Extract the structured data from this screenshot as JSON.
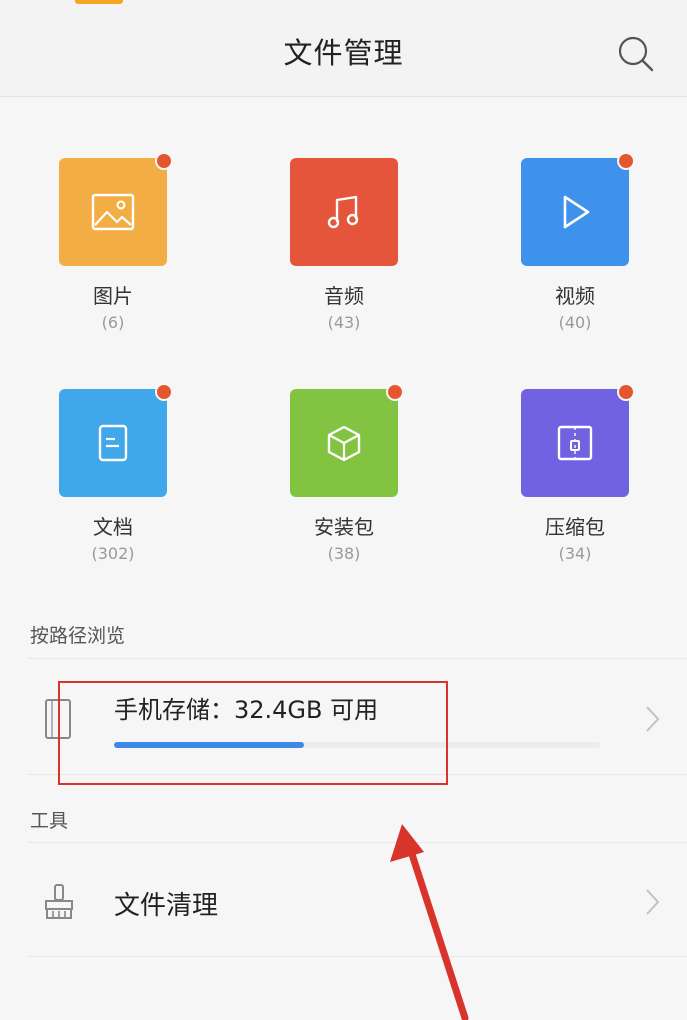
{
  "header": {
    "title": "文件管理",
    "search_icon": "search-icon"
  },
  "categories": [
    {
      "label": "图片",
      "count": "(6)",
      "color": "#f3ad45",
      "icon": "image-icon",
      "new_dot": true
    },
    {
      "label": "音频",
      "count": "(43)",
      "color": "#e4553b",
      "icon": "music-note-icon",
      "new_dot": false
    },
    {
      "label": "视频",
      "count": "(40)",
      "color": "#3f92ec",
      "icon": "play-icon",
      "new_dot": true
    },
    {
      "label": "文档",
      "count": "(302)",
      "color": "#3fa7ea",
      "icon": "document-icon",
      "new_dot": true
    },
    {
      "label": "安装包",
      "count": "(38)",
      "color": "#82c341",
      "icon": "package-box-icon",
      "new_dot": true
    },
    {
      "label": "压缩包",
      "count": "(34)",
      "color": "#7062e0",
      "icon": "zip-archive-icon",
      "new_dot": true
    }
  ],
  "browse": {
    "section_label": "按路径浏览",
    "storage_label": "手机存储：32.4GB 可用",
    "used_fraction": 0.39,
    "progress_color": "#3d8ae6"
  },
  "tools": {
    "section_label": "工具",
    "clean_label": "文件清理",
    "clean_icon": "broom-icon"
  },
  "annotation": {
    "highlight_color": "#d9342b"
  }
}
